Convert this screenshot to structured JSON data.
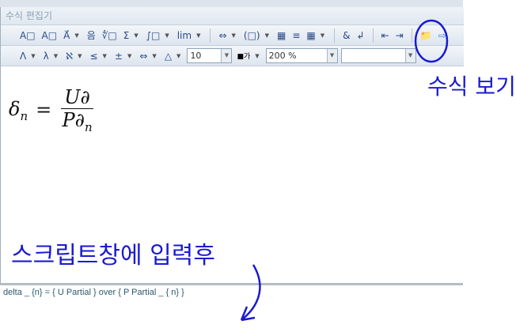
{
  "window": {
    "title": "수식 편집기"
  },
  "toolbar1": [
    "A□",
    "A□",
    "A⃗",
    "▾",
    "음",
    "∜□",
    "Σ",
    "∫□",
    "lim",
    "⇔",
    "(□)",
    "▦",
    "≡",
    "▦",
    "&",
    "↲",
    "⇤",
    "⇥",
    "📁",
    "⇨"
  ],
  "toolbar2": {
    "buttons": [
      "Λ",
      "λ",
      "ℵ",
      "≤",
      "±",
      "⇔",
      "△"
    ],
    "font_size": "10",
    "color_label": "가",
    "zoom": "200 %",
    "font": ""
  },
  "formula": {
    "lhs": "δ",
    "lhs_sub": "n",
    "eq": "=",
    "num": "U∂",
    "den": "P∂",
    "den_sub": "n"
  },
  "script": {
    "text": "delta _ {n} = { U Partial } over { P Partial _ { n} }"
  },
  "annotations": {
    "view_formula": "수식 보기",
    "after_input": "스크립트창에 입력후"
  },
  "colors": {
    "annotation": "#1a1ad0"
  }
}
